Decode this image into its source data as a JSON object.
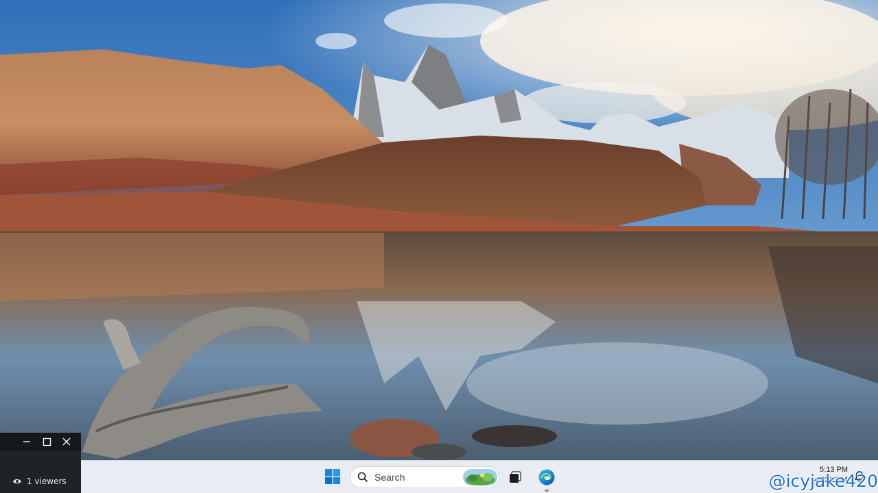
{
  "viewer_widget": {
    "viewers_label": "1 viewers",
    "minimize_icon": "minimize-icon",
    "maximize_icon": "maximize-icon",
    "close_icon": "close-icon"
  },
  "taskbar": {
    "search_label": "Search",
    "clock_time": "5:13 PM",
    "clock_date": "4/22/2024",
    "icons": [
      "windows-start-icon",
      "search-icon",
      "task-view-icon",
      "edge-browser-icon",
      "notification-icon"
    ]
  },
  "watermark": "@icyjake420",
  "colors": {
    "taskbar_bg": "#e9edf3",
    "widget_bg": "#1f2326",
    "watermark": "#1f6fe0",
    "start_blue": "#0a74da"
  }
}
